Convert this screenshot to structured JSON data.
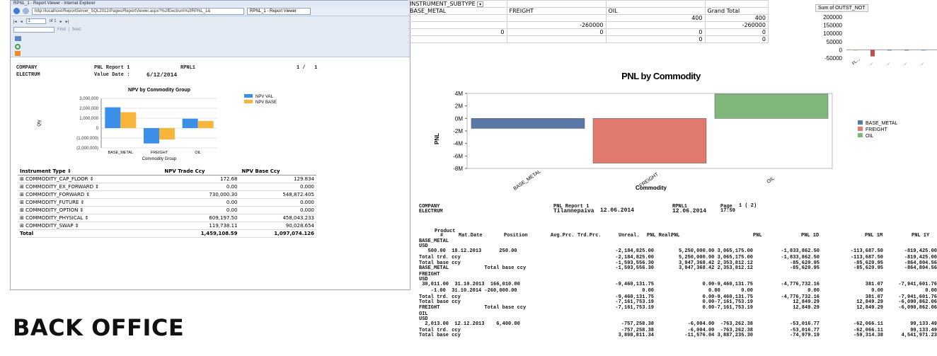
{
  "window": {
    "title": "RPNL_1 - Report Viewer - Internet Explorer",
    "url": "http://localhost/ReportServer_SQL2012/Pages/ReportViewer.aspx?%2fEectrum%2fRPNL_1&",
    "tab_label": "RPNL_1 - Report Viewer",
    "page_current": "1",
    "page_total": "of 1",
    "find_label": "Find",
    "next_label": "Next"
  },
  "report_header": {
    "company_label": "COMPANY",
    "company_value": "ELECTRUM",
    "report_name": "PNL Report 1",
    "report_code": "RPNL1",
    "value_date_label": "Value Date :",
    "value_date": "6/12/2014",
    "page": "1 /   1"
  },
  "npv_chart": {
    "chart_data": {
      "type": "bar",
      "title": "NPV by Commodity Group",
      "xlabel": "Commodity Group",
      "ylabel": "Qty",
      "categories": [
        "BASE_METAL",
        "FREIGHT",
        "OIL"
      ],
      "series": [
        {
          "name": "NPV VAL",
          "color": "#3b8fe8",
          "values": [
            2100000,
            -1550000,
            950000
          ]
        },
        {
          "name": "NPV BASE",
          "color": "#f7b53b",
          "values": [
            1600000,
            -1150000,
            720000
          ]
        }
      ],
      "ylim": [
        -2000000,
        3000000
      ],
      "ticks": [
        "3,000,000",
        "2,000,000",
        "1,000,000",
        "0",
        "(1,000,000)",
        "(2,000,000)"
      ],
      "legend": "top-right"
    }
  },
  "npv_table": {
    "headers": [
      "Instrument Type",
      "NPV Trade Ccy",
      "NPV Base Ccy"
    ],
    "rows": [
      [
        "COMMODITY_CAP_FLOOR",
        "172.68",
        "129.834"
      ],
      [
        "COMMODITY_EX_FORWARD",
        "0.00",
        "0.000"
      ],
      [
        "COMMODITY_FORWARD",
        "730,000.30",
        "548,872.405"
      ],
      [
        "COMMODITY_FUTURE",
        "0.00",
        "0.000"
      ],
      [
        "COMMODITY_OPTION",
        "0.00",
        "0.000"
      ],
      [
        "COMMODITY_PHYSICAL",
        "609,197.50",
        "458,043.233"
      ],
      [
        "COMMODITY_SWAP",
        "119,738.11",
        "90,028.654"
      ]
    ],
    "total": [
      "Total",
      "1,459,108.59",
      "1,097,074.126"
    ]
  },
  "pivot": {
    "filter_label": "INSTRUMENT_SUBTYPE",
    "headers": [
      "BASE_METAL",
      "FREIGHT",
      "OIL",
      "Grand Total"
    ],
    "rows": [
      [
        "",
        "",
        "400",
        "400"
      ],
      [
        "",
        "-260000",
        "",
        "-260000"
      ],
      [
        "0",
        "0",
        "0",
        "0"
      ],
      [
        "",
        "",
        "0",
        "0"
      ]
    ]
  },
  "outst_chart": {
    "chart_data": {
      "type": "bar",
      "title": "Sum of OUTST_NOT",
      "categories": [
        "FL...",
        "...",
        "...",
        "...",
        "..."
      ],
      "values": [
        400,
        -40000,
        0,
        0,
        0
      ],
      "ticks": [
        "200000",
        "150000",
        "100000",
        "50000",
        "0",
        "-50000"
      ],
      "ylim": [
        -50000,
        200000
      ]
    }
  },
  "pnl_chart": {
    "chart_data": {
      "type": "bar",
      "title": "PNL by Commodity",
      "xlabel": "Commodity",
      "ylabel": "PNL",
      "categories": [
        "BASE_METAL",
        "FREIGHT",
        "OIL"
      ],
      "series": [
        {
          "name": "BASE_METAL",
          "color": "#5a78a8",
          "values": [
            -1600000
          ]
        },
        {
          "name": "FREIGHT",
          "color": "#e07a6f",
          "values": [
            -7150000
          ]
        },
        {
          "name": "OIL",
          "color": "#7fb87a",
          "values": [
            3900000
          ]
        }
      ],
      "ticks": [
        "4M",
        "2M",
        "0M",
        "-2M",
        "-4M",
        "-6M",
        "-8M"
      ],
      "ylim": [
        -8000000,
        4000000
      ],
      "legend": "right"
    }
  },
  "pnl_report": {
    "company_label": "COMPANY",
    "company_value": "ELECTRUM",
    "report_name": "PNL Report 1",
    "date_label": "Tilannepaiva",
    "date": "12.06.2014",
    "code": "RPNL1",
    "code_date": "12.06.2014",
    "page_label": "Page",
    "page_num": "1 ( 2)",
    "time": "17:59",
    "col_headers": [
      "Product",
      "#",
      "Mat.Date",
      "Position",
      "Avg.Prc.",
      "Trd.Prc.",
      "Unreal.",
      "PNL Real.",
      "PNL",
      "PNL",
      "PNL 1D",
      "PNL 1M",
      "PNL 1Y"
    ],
    "lines": [
      {
        "t": "group",
        "a": "BASE_METAL"
      },
      {
        "t": "group",
        "a": "USD"
      },
      {
        "t": "data",
        "a": "   500.00  18.12.2013      250.00",
        "v": [
          "-2,184,825.00",
          "5,250,000.00 3,065,175.00",
          "-1,833,862.50",
          "-113,687.50",
          "-819,425.00"
        ]
      },
      {
        "t": "sub",
        "a": "Total trd. ccy",
        "v": [
          "-2,184,825.00",
          "5,250,000.00 3,065,175.00",
          "-1,833,862.50",
          "-113,687.50",
          "-819,425.00"
        ]
      },
      {
        "t": "sub",
        "a": "Total base ccy",
        "v": [
          "-1,593,556.30",
          "3,947,368.42 2,353,812.12",
          "-85,620.95",
          "-85,620.95",
          "-864,804.56"
        ]
      },
      {
        "t": "base",
        "a": "BASE_METAL            Total base ccy",
        "v": [
          "-1,593,556.30",
          "3,947,368.42 2,353,812.12",
          "-85,620.95",
          "-85,620.95",
          "-864,804.56"
        ]
      },
      {
        "t": "group",
        "a": "FREIGHT"
      },
      {
        "t": "group",
        "a": "USD"
      },
      {
        "t": "data",
        "a": " 30,011.00  31.10.2013  166,010.00",
        "v": [
          "-9,460,131.75",
          "0.00-9,460,131.75",
          "-4,776,732.16",
          "381.07",
          "-7,941,601.76"
        ]
      },
      {
        "t": "data",
        "a": "    -1.00  31.10.2014 -260,000.00",
        "v": [
          "0.00",
          "0.00       0.00",
          "0.00",
          "0.00",
          "0.00"
        ]
      },
      {
        "t": "sub",
        "a": "Total trd. ccy",
        "v": [
          "-9,460,131.75",
          "0.00-9,460,131.75",
          "-4,776,732.16",
          "381.07",
          "-7,941,601.76"
        ]
      },
      {
        "t": "sub",
        "a": "Total base ccy",
        "v": [
          "-7,161,753.19",
          "0.00-7,161,753.19",
          "12,849.29",
          "12,849.29",
          "-6,090,862.06"
        ]
      },
      {
        "t": "base",
        "a": "FREIGHT               Total base ccy",
        "v": [
          "-7,161,753.19",
          "0.00-7,161,753.19",
          "12,849.29",
          "12,849.29",
          "-6,090,862.06"
        ]
      },
      {
        "t": "group",
        "a": "OIL"
      },
      {
        "t": "group",
        "a": "USD"
      },
      {
        "t": "data",
        "a": "  2,013.00  12.12.2013    6,400.00",
        "v": [
          "-757,258.38",
          "-6,004.00  -763,262.38",
          "-53,016.77",
          "-62,066.11",
          "99,133.49"
        ]
      },
      {
        "t": "sub",
        "a": "Total trd. ccy",
        "v": [
          "-757,258.38",
          "-6,004.00  -763,262.38",
          "-53,016.77",
          "-62,066.11",
          "99,133.49"
        ]
      },
      {
        "t": "sub",
        "a": "Total base ccy",
        "v": [
          "3,898,811.34",
          "-11,576.04 3,887,235.30",
          "-74,979.19",
          "-59,314.38",
          "4,541,971.23"
        ]
      }
    ]
  },
  "slide_title": "BACK OFFICE"
}
